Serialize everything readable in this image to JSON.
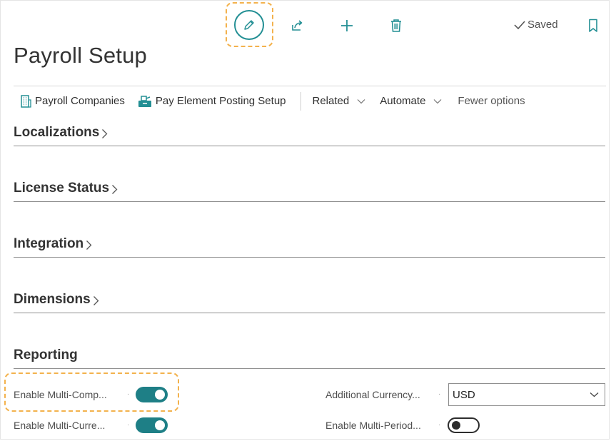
{
  "toolbar": {
    "saved_label": "Saved",
    "accent": "#238f94",
    "icons": [
      "edit-icon",
      "share-icon",
      "new-icon",
      "delete-icon",
      "bookmark-icon"
    ]
  },
  "page": {
    "title": "Payroll Setup"
  },
  "actions": {
    "payroll_companies": "Payroll Companies",
    "pay_element_posting_setup": "Pay Element Posting Setup",
    "related": "Related",
    "automate": "Automate",
    "fewer_options": "Fewer options"
  },
  "sections": {
    "localizations": "Localizations",
    "license_status": "License Status",
    "integration": "Integration",
    "dimensions": "Dimensions",
    "reporting": "Reporting"
  },
  "reporting": {
    "enable_multi_company_label": "Enable Multi-Comp...",
    "enable_multi_company_value": true,
    "enable_multi_currency_label": "Enable Multi-Curre...",
    "enable_multi_currency_value": true,
    "additional_currency_label": "Additional Currency...",
    "additional_currency_value": "USD",
    "enable_multi_period_label": "Enable Multi-Period...",
    "enable_multi_period_value": false
  }
}
